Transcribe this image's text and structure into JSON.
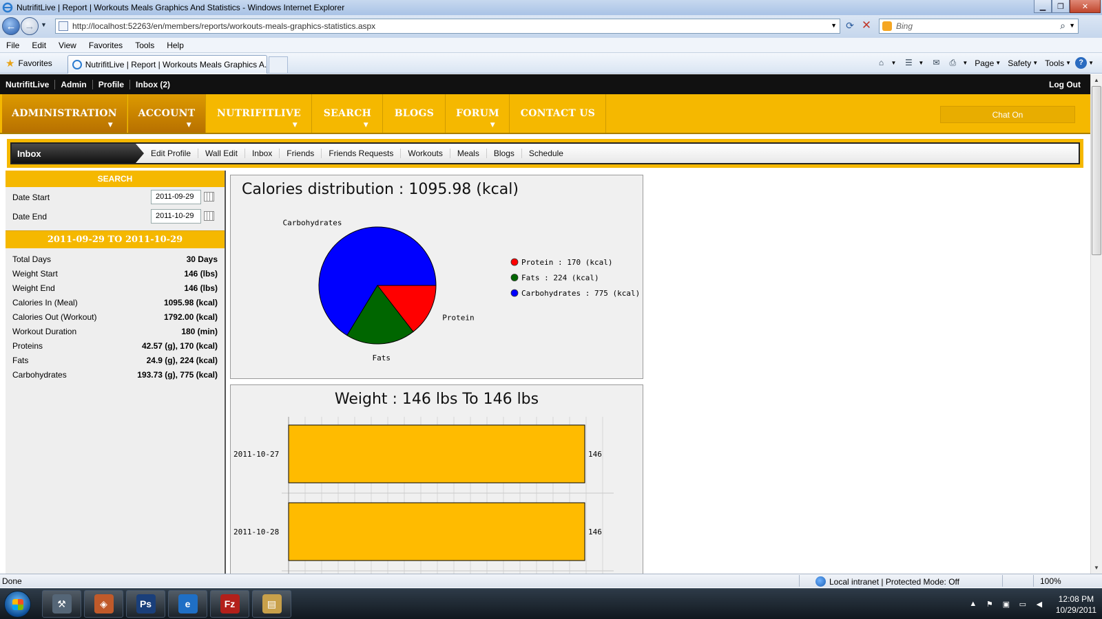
{
  "window": {
    "title": "NutrifitLive | Report | Workouts Meals Graphics And Statistics - Windows Internet Explorer",
    "url": "http://localhost:52263/en/members/reports/workouts-meals-graphics-statistics.aspx",
    "search_placeholder": "Bing",
    "menu": [
      "File",
      "Edit",
      "View",
      "Favorites",
      "Tools",
      "Help"
    ],
    "favorites_label": "Favorites",
    "tab_label": "NutrifitLive | Report | Workouts Meals Graphics A...",
    "cmd": {
      "page": "Page",
      "safety": "Safety",
      "tools": "Tools"
    }
  },
  "site": {
    "top_links": [
      "NutrifitLive",
      "Admin",
      "Profile",
      "Inbox (2)"
    ],
    "logout": "Log Out",
    "nav": [
      {
        "label": "ADMINISTRATION",
        "dark": true,
        "caret": true
      },
      {
        "label": "ACCOUNT",
        "dark": true,
        "caret": true
      },
      {
        "label": "NUTRIFITLIVE",
        "dark": false,
        "caret": true
      },
      {
        "label": "SEARCH",
        "dark": false,
        "caret": true
      },
      {
        "label": "BLOGS",
        "dark": false,
        "caret": false
      },
      {
        "label": "FORUM",
        "dark": false,
        "caret": true
      },
      {
        "label": "CONTACT US",
        "dark": false,
        "caret": false
      }
    ],
    "chat": "Chat On",
    "subnav_active": "Inbox",
    "subnav": [
      "Edit Profile",
      "Wall Edit",
      "Inbox",
      "Friends",
      "Friends Requests",
      "Workouts",
      "Meals",
      "Blogs",
      "Schedule"
    ]
  },
  "search": {
    "header": "SEARCH",
    "date_start_label": "Date Start",
    "date_start": "2011-09-29",
    "date_end_label": "Date End",
    "date_end": "2011-10-29",
    "range_header": "2011-09-29 TO 2011-10-29"
  },
  "stats": [
    {
      "label": "Total Days",
      "value": "30 Days"
    },
    {
      "label": "Weight Start",
      "value": "146 (lbs)"
    },
    {
      "label": "Weight End",
      "value": "146 (lbs)"
    },
    {
      "label": "Calories In (Meal)",
      "value": "1095.98 (kcal)"
    },
    {
      "label": "Calories Out (Workout)",
      "value": "1792.00 (kcal)"
    },
    {
      "label": "Workout Duration",
      "value": "180 (min)"
    },
    {
      "label": "Proteins",
      "value": "42.57 (g), 170 (kcal)"
    },
    {
      "label": "Fats",
      "value": "24.9 (g), 224 (kcal)"
    },
    {
      "label": "Carbohydrates",
      "value": "193.73 (g), 775 (kcal)"
    }
  ],
  "chart_data": [
    {
      "type": "pie",
      "title": "Calories distribution : 1095.98 (kcal)",
      "slices": [
        {
          "name": "Protein",
          "value": 170,
          "color": "#ff0000",
          "legend": "Protein : 170 (kcal)"
        },
        {
          "name": "Fats",
          "value": 224,
          "color": "#006600",
          "legend": "Fats : 224 (kcal)"
        },
        {
          "name": "Carbohydrates",
          "value": 775,
          "color": "#0000ff",
          "legend": "Carbohydrates : 775 (kcal)"
        }
      ],
      "legend_position": "right"
    },
    {
      "type": "bar",
      "orientation": "horizontal",
      "title": "Weight : 146 lbs To 146 lbs",
      "categories": [
        "2011-10-27",
        "2011-10-28"
      ],
      "values": [
        146,
        146
      ],
      "color": "#ffbb00",
      "show_data_labels": true,
      "grid": true
    }
  ],
  "status": {
    "left": "Done",
    "zone": "Local intranet | Protected Mode: Off",
    "zoom": "100%"
  },
  "taskbar": {
    "clock_time": "12:08 PM",
    "clock_date": "10/29/2011",
    "apps": [
      {
        "name": "tools",
        "color": "#556677",
        "glyph": "⚒"
      },
      {
        "name": "paint",
        "color": "#c05a2a",
        "glyph": "◈"
      },
      {
        "name": "photoshop",
        "color": "#1a3f7a",
        "glyph": "Ps"
      },
      {
        "name": "internet-explorer",
        "color": "#1f6fc5",
        "glyph": "e"
      },
      {
        "name": "filezilla",
        "color": "#b3201a",
        "glyph": "Fz"
      },
      {
        "name": "explorer",
        "color": "#c8a04a",
        "glyph": "▤"
      }
    ]
  }
}
